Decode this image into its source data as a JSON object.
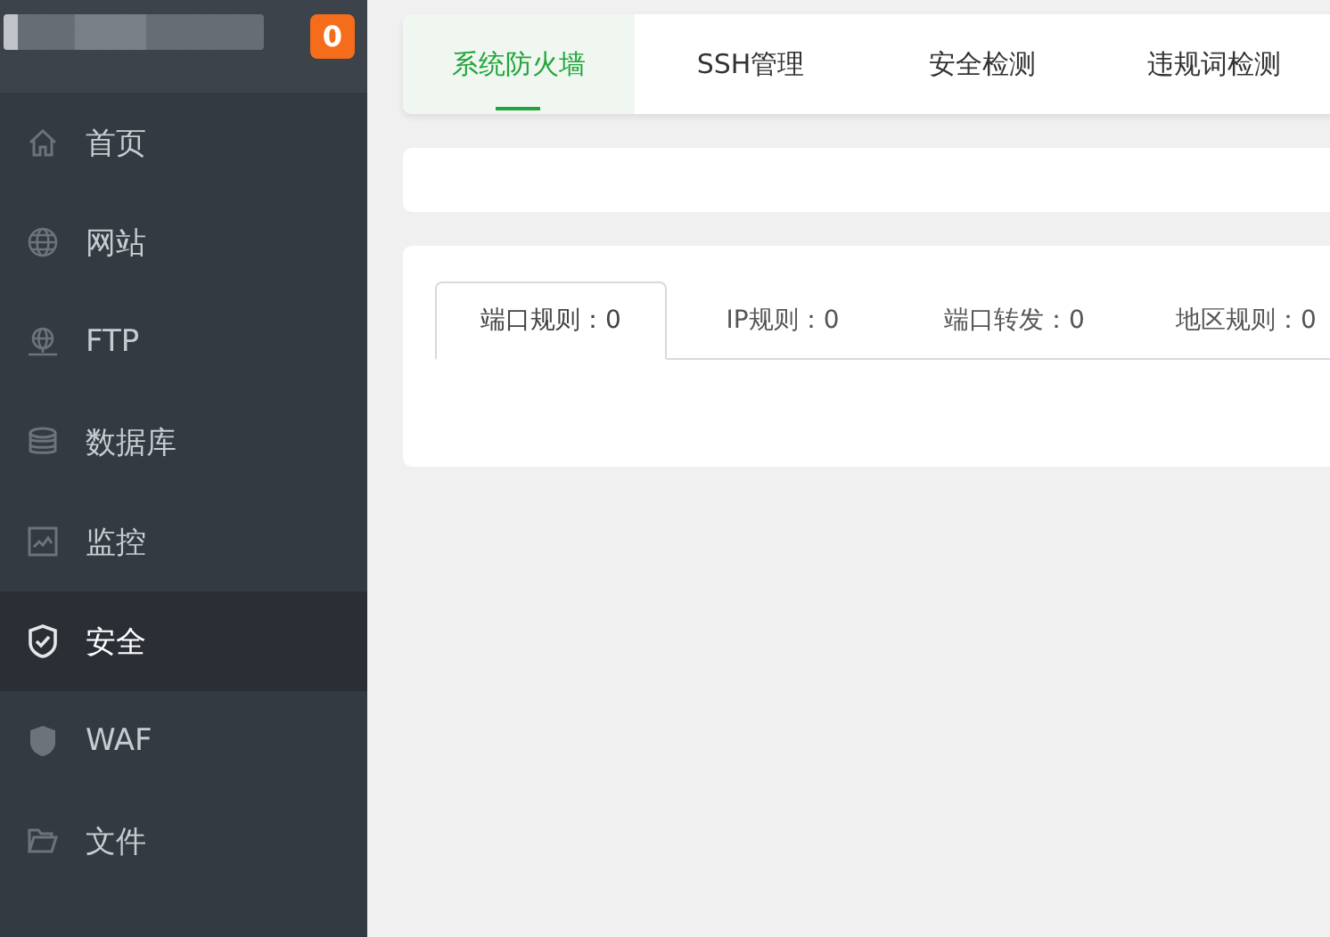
{
  "sidebar": {
    "badge": "0",
    "items": [
      {
        "label": "首页",
        "selected": false
      },
      {
        "label": "网站",
        "selected": false
      },
      {
        "label": "FTP",
        "selected": false
      },
      {
        "label": "数据库",
        "selected": false
      },
      {
        "label": "监控",
        "selected": false
      },
      {
        "label": "安全",
        "selected": true
      },
      {
        "label": "WAF",
        "selected": false
      },
      {
        "label": "文件",
        "selected": false
      }
    ]
  },
  "top_tabs": [
    {
      "label": "系统防火墙",
      "selected": true
    },
    {
      "label": "SSH管理",
      "selected": false
    },
    {
      "label": "安全检测",
      "selected": false
    },
    {
      "label": "违规词检测",
      "selected": false
    }
  ],
  "rule_tabs": [
    {
      "label": "端口规则：0",
      "selected": true
    },
    {
      "label": "IP规则：0",
      "selected": false
    },
    {
      "label": "端口转发：0",
      "selected": false
    },
    {
      "label": "地区规则：0",
      "selected": false
    }
  ]
}
